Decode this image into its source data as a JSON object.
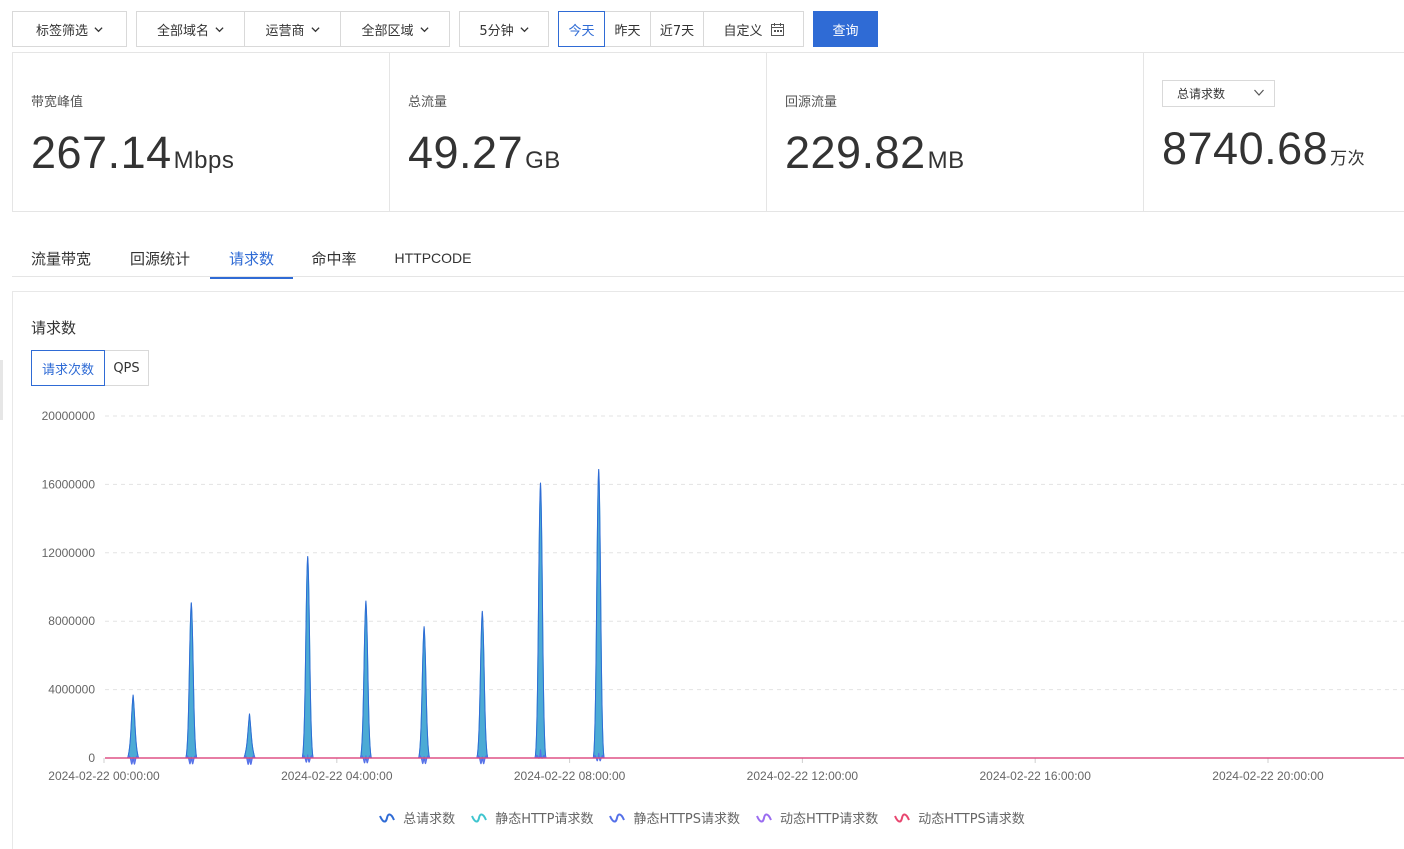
{
  "toolbar": {
    "tag_filter": "标签筛选",
    "domains": "全部域名",
    "isp": "运营商",
    "region": "全部区域",
    "interval": "5分钟",
    "range_today": "今天",
    "range_yesterday": "昨天",
    "range_7days": "近7天",
    "custom": "自定义",
    "query": "查询"
  },
  "stats": [
    {
      "label": "带宽峰值",
      "value": "267.14",
      "unit": "Mbps"
    },
    {
      "label": "总流量",
      "value": "49.27",
      "unit": "GB"
    },
    {
      "label": "回源流量",
      "value": "229.82",
      "unit": "MB"
    },
    {
      "select": "总请求数",
      "value": "8740.68",
      "unit": "万次"
    }
  ],
  "tabs": [
    "流量带宽",
    "回源统计",
    "请求数",
    "命中率",
    "HTTPCODE"
  ],
  "active_tab": "请求数",
  "panel": {
    "title": "请求数",
    "toggle_count": "请求次数",
    "toggle_qps": "QPS"
  },
  "colors": {
    "accent": "#2f6bd5",
    "total": "#2f6bd5",
    "static_http": "#3fc5cf",
    "static_https": "#5470e8",
    "dynamic_http": "#9a6cf0",
    "dynamic_https": "#e8466f"
  },
  "chart_data": {
    "type": "area",
    "ylim": [
      0,
      20000000
    ],
    "yticks": [
      "0",
      "4000000",
      "8000000",
      "12000000",
      "16000000",
      "20000000"
    ],
    "xticks": [
      "2024-02-22 00:00:00",
      "2024-02-22 04:00:00",
      "2024-02-22 08:00:00",
      "2024-02-22 12:00:00",
      "2024-02-22 16:00:00",
      "2024-02-22 20:00:00"
    ],
    "x_range_hours": [
      0,
      24
    ],
    "grid": true,
    "legend_position": "bottom",
    "series": [
      {
        "name": "总请求数",
        "color": "#2f6bd5",
        "peaks": [
          {
            "h": 0.5,
            "v": 3700000
          },
          {
            "h": 1.5,
            "v": 9100000
          },
          {
            "h": 2.5,
            "v": 2600000
          },
          {
            "h": 3.5,
            "v": 11800000
          },
          {
            "h": 4.5,
            "v": 9200000
          },
          {
            "h": 5.5,
            "v": 7700000
          },
          {
            "h": 6.5,
            "v": 8600000
          },
          {
            "h": 7.5,
            "v": 16100000
          },
          {
            "h": 8.5,
            "v": 16900000
          }
        ]
      },
      {
        "name": "静态HTTP请求数",
        "color": "#3fc5cf",
        "peaks": [
          {
            "h": 0.5,
            "v": 3650000
          },
          {
            "h": 1.5,
            "v": 9050000
          },
          {
            "h": 2.5,
            "v": 2550000
          },
          {
            "h": 3.5,
            "v": 11700000
          },
          {
            "h": 4.5,
            "v": 9100000
          },
          {
            "h": 5.5,
            "v": 7600000
          },
          {
            "h": 6.5,
            "v": 8500000
          },
          {
            "h": 7.5,
            "v": 15800000
          },
          {
            "h": 8.5,
            "v": 16700000
          }
        ]
      },
      {
        "name": "静态HTTPS请求数",
        "color": "#5470e8",
        "peaks": [
          {
            "h": 0.5,
            "v": 60000
          },
          {
            "h": 1.5,
            "v": 80000
          },
          {
            "h": 2.5,
            "v": 40000
          },
          {
            "h": 3.5,
            "v": 200000
          },
          {
            "h": 4.5,
            "v": 150000
          },
          {
            "h": 5.5,
            "v": 100000
          },
          {
            "h": 6.5,
            "v": 90000
          },
          {
            "h": 7.5,
            "v": 500000
          },
          {
            "h": 8.5,
            "v": 300000
          }
        ]
      },
      {
        "name": "动态HTTP请求数",
        "color": "#9a6cf0",
        "peaks": []
      },
      {
        "name": "动态HTTPS请求数",
        "color": "#e8466f",
        "peaks": []
      }
    ]
  }
}
